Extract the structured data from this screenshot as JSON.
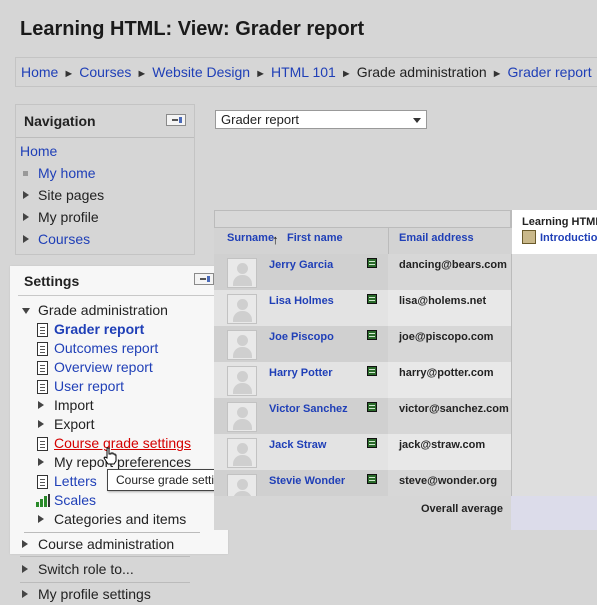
{
  "page": {
    "title": "Learning HTML: View: Grader report"
  },
  "breadcrumb": {
    "items": [
      {
        "label": "Home",
        "link": true
      },
      {
        "label": "Courses",
        "link": true
      },
      {
        "label": "Website Design",
        "link": true
      },
      {
        "label": "HTML 101",
        "link": true
      },
      {
        "label": "Grade administration",
        "link": false
      },
      {
        "label": "Grader report",
        "link": true
      }
    ],
    "separator": "►"
  },
  "navigation": {
    "title": "Navigation",
    "home": "Home",
    "my_home": "My home",
    "site_pages": "Site pages",
    "my_profile": "My profile",
    "courses": "Courses"
  },
  "settings": {
    "title": "Settings",
    "grade_admin": "Grade administration",
    "grader_report": "Grader report",
    "outcomes_report": "Outcomes report",
    "overview_report": "Overview report",
    "user_report": "User report",
    "import": "Import",
    "export": "Export",
    "course_grade_settings": "Course grade settings",
    "my_report_preferences": "My report preferences",
    "letters": "Letters",
    "scales": "Scales",
    "categories_items": "Categories and items",
    "course_admin": "Course administration",
    "switch_role": "Switch role to...",
    "my_profile_settings": "My profile settings"
  },
  "tooltip": {
    "text": "Course grade settings"
  },
  "report_select": {
    "selected": "Grader report"
  },
  "grader": {
    "course_title": "Learning HTML",
    "course_item": "Introduction",
    "headers": {
      "surname": "Surname",
      "first_name": "First name",
      "email": "Email address"
    },
    "sort_arrow": "↑",
    "rows": [
      {
        "name": "Jerry Garcia",
        "email": "dancing@bears.com"
      },
      {
        "name": "Lisa Holmes",
        "email": "lisa@holems.net"
      },
      {
        "name": "Joe Piscopo",
        "email": "joe@piscopo.com"
      },
      {
        "name": "Harry Potter",
        "email": "harry@potter.com"
      },
      {
        "name": "Victor Sanchez",
        "email": "victor@sanchez.com"
      },
      {
        "name": "Jack Straw",
        "email": "jack@straw.com"
      },
      {
        "name": "Stevie Wonder",
        "email": "steve@wonder.org"
      }
    ],
    "overall_average": "Overall average"
  }
}
